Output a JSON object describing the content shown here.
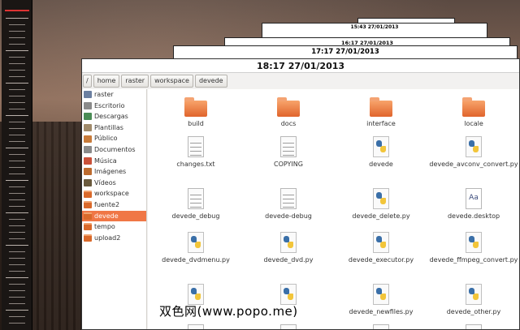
{
  "desktop": {
    "stacked_windows": [
      "",
      "15:43 27/01/2013",
      "16:17 27/01/2013",
      "17:17 27/01/2013"
    ]
  },
  "window": {
    "title": "18:17 27/01/2013"
  },
  "pathbar": {
    "root": "/",
    "crumbs": [
      "home",
      "raster",
      "workspace",
      "devede"
    ]
  },
  "sidebar": {
    "items": [
      {
        "label": "raster",
        "icon": "user-home-icon"
      },
      {
        "label": "Escritorio",
        "icon": "desktop-folder-icon"
      },
      {
        "label": "Descargas",
        "icon": "download-folder-icon"
      },
      {
        "label": "Plantillas",
        "icon": "templates-folder-icon"
      },
      {
        "label": "Público",
        "icon": "public-folder-icon"
      },
      {
        "label": "Documentos",
        "icon": "documents-folder-icon"
      },
      {
        "label": "Música",
        "icon": "music-folder-icon"
      },
      {
        "label": "Imágenes",
        "icon": "pictures-folder-icon"
      },
      {
        "label": "Vídeos",
        "icon": "videos-folder-icon"
      },
      {
        "label": "workspace",
        "icon": "folder-icon"
      },
      {
        "label": "fuente2",
        "icon": "folder-icon"
      },
      {
        "label": "devede",
        "icon": "folder-icon",
        "selected": true
      },
      {
        "label": "tempo",
        "icon": "folder-icon"
      },
      {
        "label": "upload2",
        "icon": "folder-icon"
      }
    ]
  },
  "files": [
    {
      "name": "build",
      "type": "folder"
    },
    {
      "name": "docs",
      "type": "folder"
    },
    {
      "name": "interface",
      "type": "folder"
    },
    {
      "name": "locale",
      "type": "folder"
    },
    {
      "name": "changes.txt",
      "type": "text"
    },
    {
      "name": "COPYING",
      "type": "text"
    },
    {
      "name": "devede",
      "type": "python"
    },
    {
      "name": "devede_avconv_convert.py",
      "type": "python"
    },
    {
      "name": "devede_debug",
      "type": "text"
    },
    {
      "name": "devede-debug",
      "type": "text"
    },
    {
      "name": "devede_delete.py",
      "type": "python"
    },
    {
      "name": "devede.desktop",
      "type": "desktop"
    },
    {
      "name": "devede_dvdmenu.py",
      "type": "python"
    },
    {
      "name": "devede_dvd.py",
      "type": "python"
    },
    {
      "name": "devede_executor.py",
      "type": "python"
    },
    {
      "name": "devede_ffmpeg_convert.py",
      "type": "python"
    },
    {
      "name": "",
      "type": "python"
    },
    {
      "name": "",
      "type": "python"
    },
    {
      "name": "devede_newfiles.py",
      "type": "python"
    },
    {
      "name": "devede_other.py",
      "type": "python"
    }
  ],
  "watermark": "双色网(www.popo.me)"
}
